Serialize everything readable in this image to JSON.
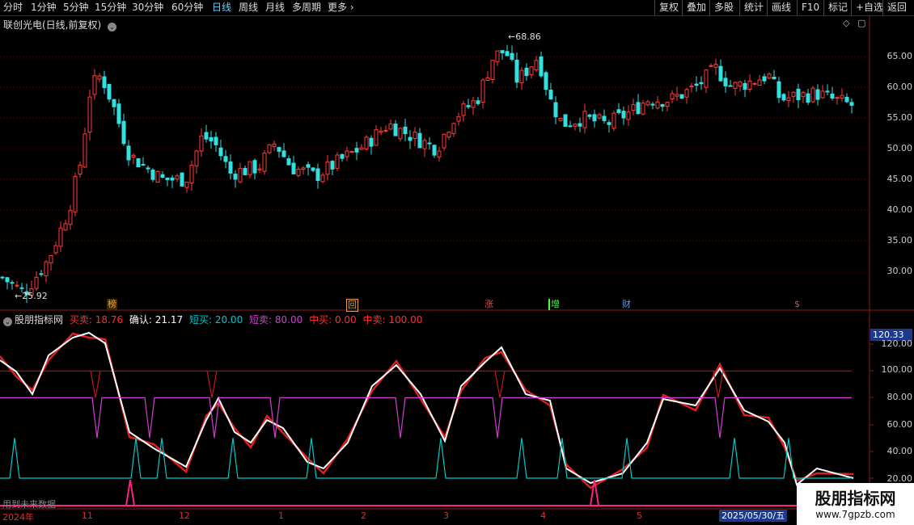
{
  "toolbar": {
    "timeframes": [
      "分时",
      "1分钟",
      "5分钟",
      "15分钟",
      "30分钟",
      "60分钟",
      "日线",
      "周线",
      "月线",
      "多周期",
      "更多"
    ],
    "active": "日线",
    "buttons": [
      "复权",
      "叠加",
      "多股",
      "统计",
      "画线",
      "F10",
      "标记",
      "+自选",
      "返回"
    ]
  },
  "main": {
    "title": "联创光电(日线,前复权)",
    "price_labels": [
      "65.00",
      "60.00",
      "55.00",
      "50.00",
      "45.00",
      "40.00",
      "35.00",
      "30.00"
    ],
    "high_label": "68.86",
    "low_label": "25.92",
    "markers": [
      {
        "text": "榜",
        "color": "#e8a040"
      },
      {
        "text": "回",
        "color": "#e8a040"
      },
      {
        "text": "涨",
        "color": "#ff4040"
      },
      {
        "text": "增",
        "color": "#40ff40"
      },
      {
        "text": "财",
        "color": "#4aa0ff"
      },
      {
        "text": "$",
        "color": "#ff4040"
      }
    ]
  },
  "indicator": {
    "title": "股朋指标网",
    "values": [
      {
        "label": "买卖:",
        "value": "18.76",
        "color": "#ff3030"
      },
      {
        "label": "确认:",
        "value": "21.17",
        "color": "#ffffff"
      },
      {
        "label": "短买:",
        "value": "20.00",
        "color": "#00c8c8"
      },
      {
        "label": "短卖:",
        "value": "80.00",
        "color": "#d040d0"
      },
      {
        "label": "中买:",
        "value": "0.00",
        "color": "#ff3030"
      },
      {
        "label": "中卖:",
        "value": "100.00",
        "color": "#ff3030"
      }
    ],
    "current_label": "120.33",
    "y_labels": [
      "120.00",
      "100.00",
      "80.00",
      "60.00",
      "40.00",
      "20.00"
    ],
    "future_note": "用到未来数据"
  },
  "x_axis": {
    "labels": [
      "2024年",
      "11",
      "12",
      "1",
      "2",
      "3",
      "4",
      "5"
    ],
    "cursor_date": "2025/05/30/五"
  },
  "watermark": {
    "title": "股朋指标网",
    "url": "www.7gpzb.com"
  }
}
